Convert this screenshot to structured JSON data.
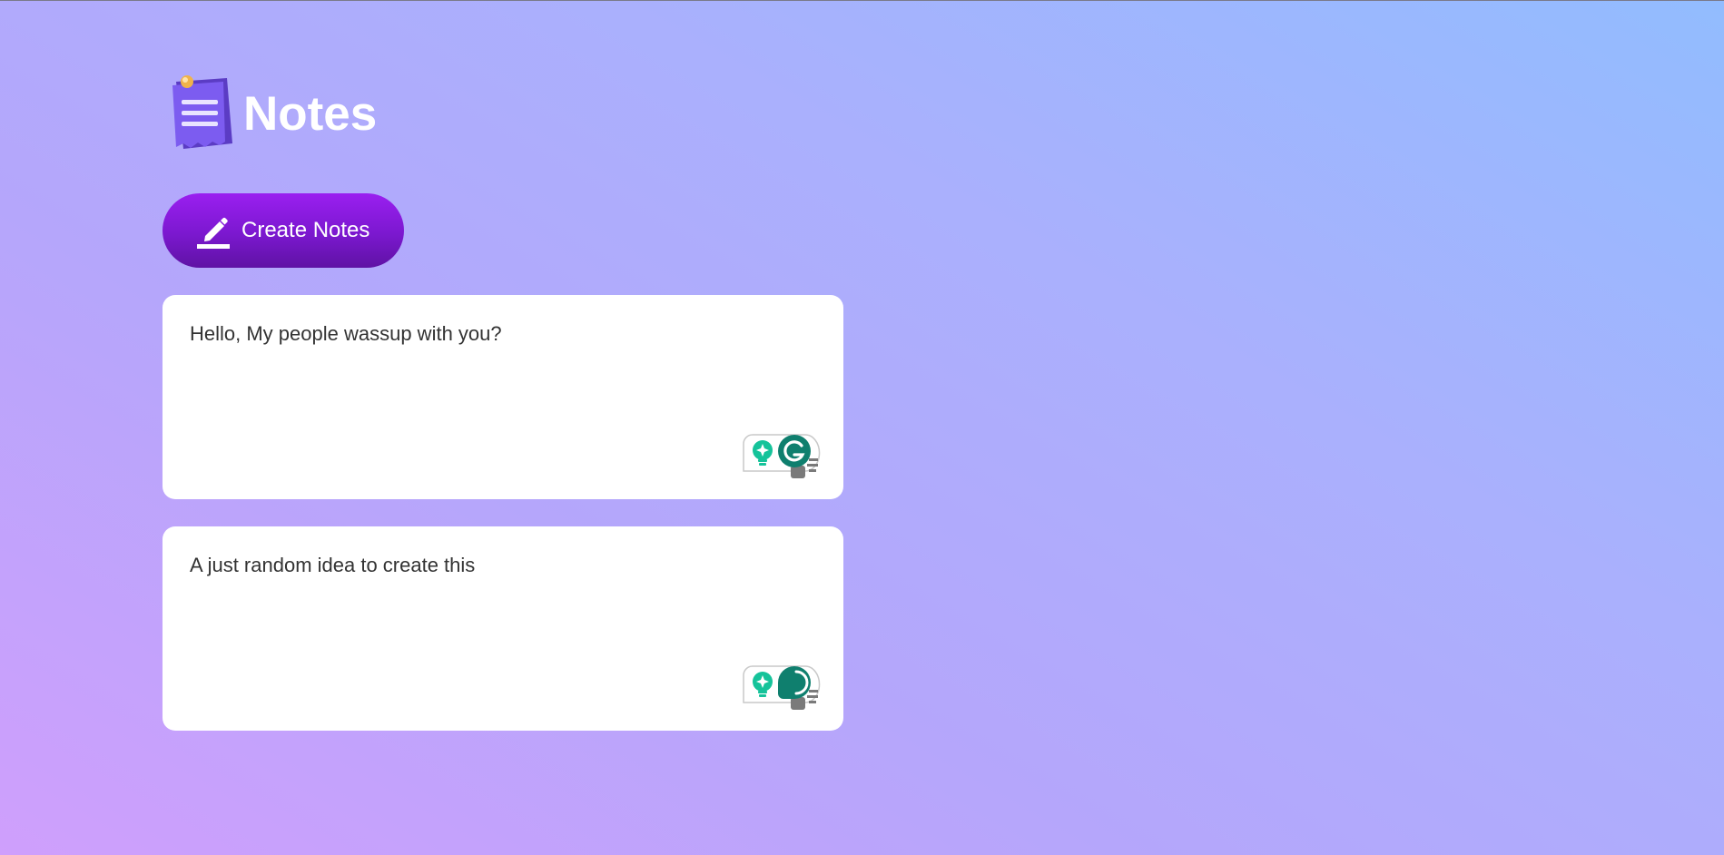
{
  "app": {
    "title": "Notes",
    "logo_icon": "notepad-icon"
  },
  "toolbar": {
    "create_label": "Create Notes",
    "create_icon": "pencil-icon"
  },
  "notes": [
    {
      "text": "Hello, My people wassup with you?"
    },
    {
      "text": "A just random idea to create this"
    }
  ],
  "colors": {
    "accent": "#8a1be6",
    "grammarly_green": "#0f7f6e",
    "bulb_teal": "#15c39a"
  }
}
